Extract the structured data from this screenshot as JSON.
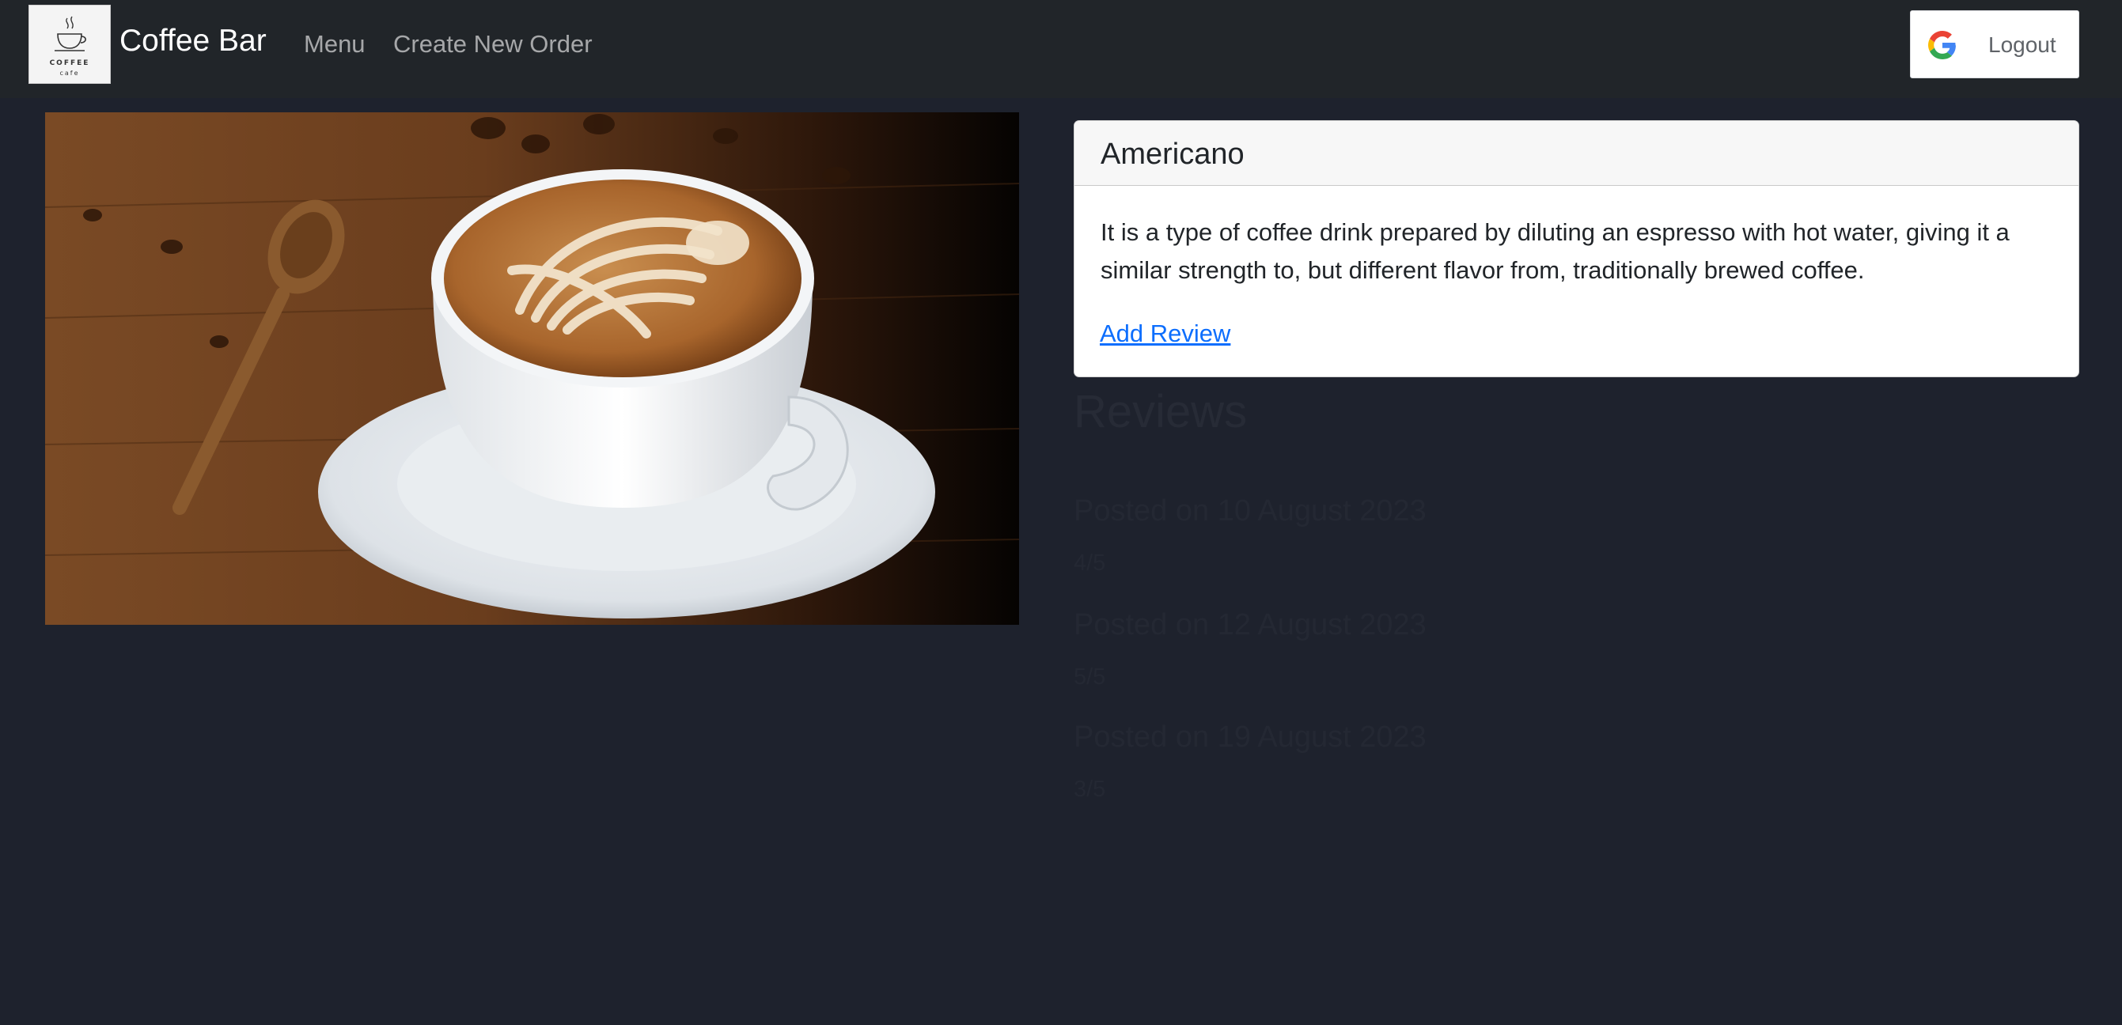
{
  "navbar": {
    "brand_name": "Coffee Bar",
    "logo_line1": "COFFEE",
    "logo_line2": "cafe",
    "menu_label": "Menu",
    "create_order_label": "Create New Order",
    "logout_label": "Logout",
    "logout_icon": "google-g-icon"
  },
  "hero": {
    "image_subject": "latte-art-coffee-cup"
  },
  "product": {
    "name": "Americano",
    "description": "It is a type of coffee drink prepared by diluting an espresso with hot water, giving it a similar strength to, but different flavor from, traditionally brewed coffee.",
    "add_review_label": "Add Review"
  },
  "reviews": {
    "title": "Reviews",
    "items": [
      {
        "heading": "Posted on 10 August 2023",
        "rating": "4/5"
      },
      {
        "heading": "Posted on 12 August 2023",
        "rating": "5/5"
      },
      {
        "heading": "Posted on 19 August 2023",
        "rating": "3/5"
      }
    ]
  },
  "colors": {
    "page_background": "#1e222d",
    "navbar_background": "#212529",
    "link_blue": "#0d6efd",
    "card_header_background": "#f7f7f7"
  }
}
